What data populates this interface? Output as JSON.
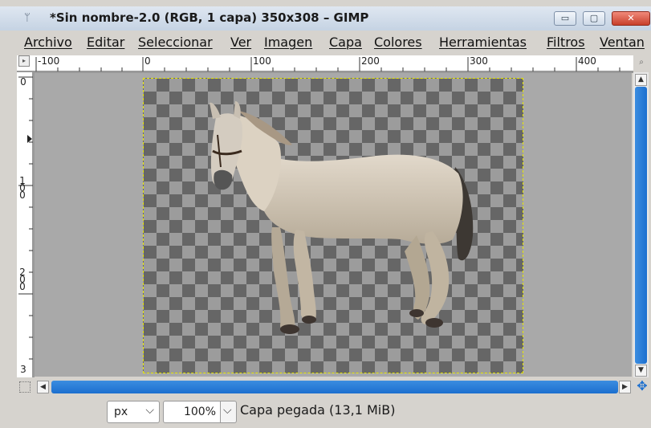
{
  "window": {
    "title": "*Sin nombre-2.0 (RGB, 1 capa) 350x308 – GIMP",
    "minimize_glyph": "▭",
    "maximize_glyph": "▢",
    "close_glyph": "✕"
  },
  "menubar": {
    "items": [
      {
        "label": "Archivo"
      },
      {
        "label": "Editar"
      },
      {
        "label": "Seleccionar"
      },
      {
        "label": "Ver"
      },
      {
        "label": "Imagen"
      },
      {
        "label": "Capa"
      },
      {
        "label": "Colores"
      },
      {
        "label": "Herramientas"
      },
      {
        "label": "Filtros"
      },
      {
        "label": "Ventan"
      }
    ]
  },
  "rulers": {
    "horizontal_labels": [
      "-100",
      "0",
      "100",
      "200",
      "300",
      "400"
    ],
    "vertical_labels": [
      "0",
      "100",
      "200",
      "3"
    ]
  },
  "statusbar": {
    "unit": "px",
    "zoom": "100%",
    "layer_info": "Capa pegada (13,1 MiB)"
  },
  "icons": {
    "app": "gimp-wilber-icon",
    "ruler_corner": "menu-triangle-icon",
    "zoom": "zoom-icon",
    "navigate": "navigate-icon",
    "quickmask": "quickmask-icon"
  },
  "colors": {
    "scroll_accent": "#1c6fcf",
    "selection_marching_ants": "#e6e600"
  }
}
